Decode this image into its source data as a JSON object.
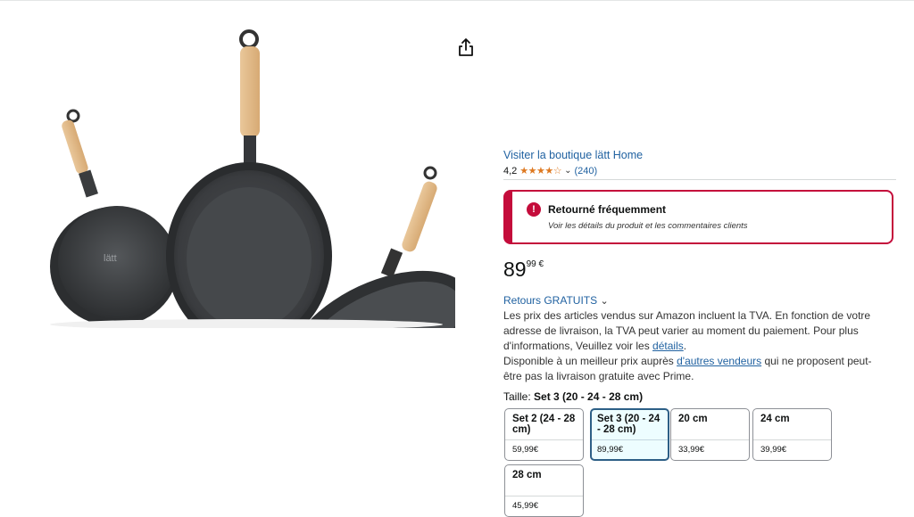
{
  "product_image": {
    "logo_text": "lätt"
  },
  "share": {
    "icon": "share-icon"
  },
  "store": {
    "link": "Visiter la boutique lätt Home"
  },
  "rating": {
    "value": "4,2",
    "stars": "★★★★☆",
    "count": "(240)",
    "chevron": "⌄"
  },
  "alert": {
    "icon": "!",
    "title": "Retourné fréquemment",
    "subtitle": "Voir les détails du produit et les commentaires clients",
    "color": "#c40c3b"
  },
  "price": {
    "whole": "89",
    "fraction": "99 €"
  },
  "returns": {
    "label": "Retours GRATUITS",
    "chevron": "⌄"
  },
  "description": {
    "part1": "Les prix des articles vendus sur Amazon incluent la TVA. En fonction de votre adresse de livraison, la TVA peut varier au moment du paiement. Pour plus d'informations, Veuillez voir les ",
    "details_link": "détails",
    "part2": ".",
    "part3": "Disponible à un meilleur prix auprès ",
    "other_sellers_link": "d'autres vendeurs",
    "part4": " qui ne proposent peut-être pas la livraison gratuite avec Prime."
  },
  "size": {
    "label": "Taille:",
    "selected": "Set 3 (20 - 24 - 28 cm)",
    "options": [
      {
        "name": "Set 2 (24 - 28 cm)",
        "price": "59,99€",
        "selected": false
      },
      {
        "name": "Set 3 (20 - 24 - 28 cm)",
        "price": "89,99€",
        "selected": true
      },
      {
        "name": "20 cm",
        "price": "33,99€",
        "selected": false
      },
      {
        "name": "24 cm",
        "price": "39,99€",
        "selected": false
      },
      {
        "name": "28 cm",
        "price": "45,99€",
        "selected": false
      }
    ]
  }
}
